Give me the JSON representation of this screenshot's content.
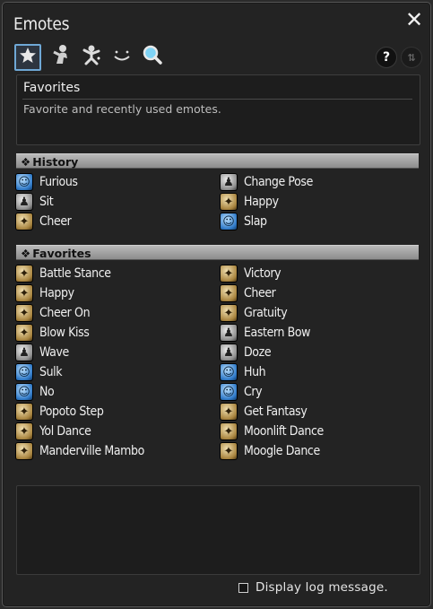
{
  "window": {
    "title": "Emotes"
  },
  "tabs": [
    {
      "name": "favorites-tab",
      "icon": "star-icon",
      "active": true
    },
    {
      "name": "general-tab",
      "icon": "person-icon",
      "active": false
    },
    {
      "name": "special-tab",
      "icon": "dancer-icon",
      "active": false
    },
    {
      "name": "expressions-tab",
      "icon": "smile-icon",
      "active": false
    },
    {
      "name": "search-tab",
      "icon": "search-icon",
      "active": false
    }
  ],
  "description": {
    "title": "Favorites",
    "text": "Favorite and recently used emotes."
  },
  "history": {
    "label": "History",
    "items": [
      {
        "label": "Furious",
        "icon": "furious-icon",
        "color": "blue"
      },
      {
        "label": "Change Pose",
        "icon": "change-pose-icon",
        "color": "gray"
      },
      {
        "label": "Sit",
        "icon": "sit-icon",
        "color": "gray"
      },
      {
        "label": "Happy",
        "icon": "happy-icon",
        "color": "gold"
      },
      {
        "label": "Cheer",
        "icon": "cheer-icon",
        "color": "gold"
      },
      {
        "label": "Slap",
        "icon": "slap-icon",
        "color": "blue"
      }
    ]
  },
  "favorites": {
    "label": "Favorites",
    "items": [
      {
        "label": "Battle Stance",
        "icon": "battle-stance-icon",
        "color": "gold"
      },
      {
        "label": "Victory",
        "icon": "victory-icon",
        "color": "gold"
      },
      {
        "label": "Happy",
        "icon": "happy-icon",
        "color": "gold"
      },
      {
        "label": "Cheer",
        "icon": "cheer-icon",
        "color": "gold"
      },
      {
        "label": "Cheer On",
        "icon": "cheer-on-icon",
        "color": "gold"
      },
      {
        "label": "Gratuity",
        "icon": "gratuity-icon",
        "color": "gold"
      },
      {
        "label": "Blow Kiss",
        "icon": "blow-kiss-icon",
        "color": "gold"
      },
      {
        "label": "Eastern Bow",
        "icon": "eastern-bow-icon",
        "color": "gray"
      },
      {
        "label": "Wave",
        "icon": "wave-icon",
        "color": "gray"
      },
      {
        "label": "Doze",
        "icon": "doze-icon",
        "color": "gray"
      },
      {
        "label": "Sulk",
        "icon": "sulk-icon",
        "color": "blue"
      },
      {
        "label": "Huh",
        "icon": "huh-icon",
        "color": "blue"
      },
      {
        "label": "No",
        "icon": "no-icon",
        "color": "blue"
      },
      {
        "label": "Cry",
        "icon": "cry-icon",
        "color": "blue"
      },
      {
        "label": "Popoto Step",
        "icon": "popoto-step-icon",
        "color": "gold"
      },
      {
        "label": "Get Fantasy",
        "icon": "get-fantasy-icon",
        "color": "gold"
      },
      {
        "label": "Yol Dance",
        "icon": "yol-dance-icon",
        "color": "gold"
      },
      {
        "label": "Moonlift Dance",
        "icon": "moonlift-dance-icon",
        "color": "gold"
      },
      {
        "label": "Manderville Mambo",
        "icon": "manderville-mambo-icon",
        "color": "gold"
      },
      {
        "label": "Moogle Dance",
        "icon": "moogle-dance-icon",
        "color": "gold"
      }
    ]
  },
  "log_option": {
    "label": "Display log message.",
    "checked": false
  },
  "buttons": {
    "help": "?",
    "close": "✕",
    "sort": "⇅"
  },
  "colors": {
    "accent": "#6fa8d6",
    "header": "#a8a8a8",
    "background": "#232323"
  }
}
